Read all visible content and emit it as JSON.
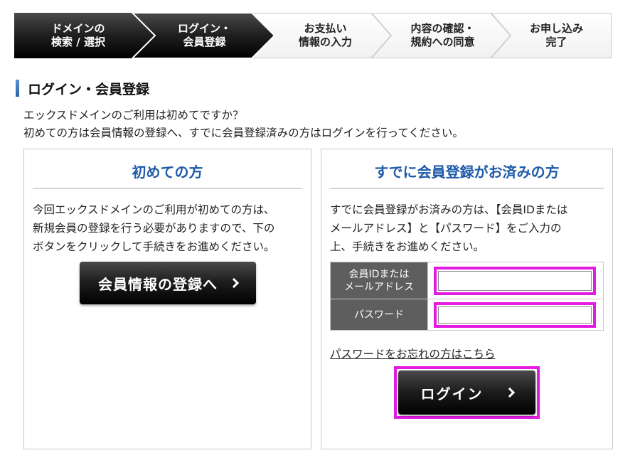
{
  "steps": [
    {
      "label": "ドメインの\n検索 / 選択",
      "state": "done"
    },
    {
      "label": "ログイン・\n会員登録",
      "state": "current"
    },
    {
      "label": "お支払い\n情報の入力",
      "state": "todo"
    },
    {
      "label": "内容の確認・\n規約への同意",
      "state": "todo"
    },
    {
      "label": "お申し込み\n完了",
      "state": "todo"
    }
  ],
  "section": {
    "title": "ログイン・会員登録"
  },
  "intro": {
    "line1": "エックスドメインのご利用は初めてですか？",
    "line2": "初めての方は会員情報の登録へ、すでに会員登録済みの方はログインを行ってください。"
  },
  "new_user": {
    "title": "初めての方",
    "text_lines": [
      "今回エックスドメインのご利用が初めての方は、",
      "新規会員の登録を行う必要がありますので、下の",
      "ボタンをクリックして手続きをお進めください。"
    ],
    "button_label": "会員情報の登録へ"
  },
  "member": {
    "title": "すでに会員登録がお済みの方",
    "text_lines": [
      "すでに会員登録がお済みの方は、【会員IDまたは",
      "メールアドレス】と【パスワード】をご入力の",
      "上、手続きをお進めください。"
    ],
    "id_label_1": "会員IDまたは",
    "id_label_2": "メールアドレス",
    "id_value": "",
    "password_label": "パスワード",
    "password_value": "",
    "forgot_link": "パスワードをお忘れの方はこちら",
    "login_button": "ログイン"
  },
  "colors": {
    "highlight": "#e31be0",
    "heading_blue": "#1e5aa7",
    "step_done": "#1a1a1a",
    "label_bg": "#5e5e5e"
  }
}
